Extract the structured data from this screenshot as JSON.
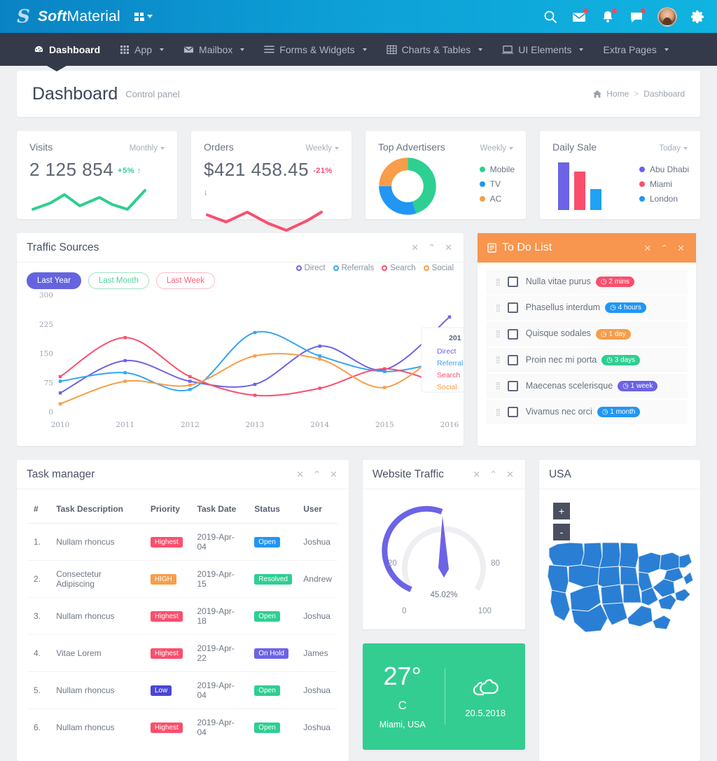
{
  "brand": {
    "bold": "Soft",
    "light": "Material",
    "logo_icon": "s-monogram-icon"
  },
  "topbar": {
    "grid_toggle_icon": "grid-apps-icon",
    "icons": [
      {
        "name": "search-icon",
        "badge": false
      },
      {
        "name": "envelope-icon",
        "badge": true
      },
      {
        "name": "bell-icon",
        "badge": true
      },
      {
        "name": "chat-icon",
        "badge": true
      }
    ],
    "avatar_alt": "user-avatar",
    "settings_icon": "gear-icon"
  },
  "nav": [
    {
      "label": "Dashboard",
      "icon": "dashboard-icon",
      "active": true,
      "caret": false
    },
    {
      "label": "App",
      "icon": "apps-grid-icon",
      "active": false,
      "caret": true
    },
    {
      "label": "Mailbox",
      "icon": "envelope-icon",
      "active": false,
      "caret": true
    },
    {
      "label": "Forms & Widgets",
      "icon": "list-lines-icon",
      "active": false,
      "caret": true
    },
    {
      "label": "Charts & Tables",
      "icon": "table-icon",
      "active": false,
      "caret": true
    },
    {
      "label": "UI Elements",
      "icon": "monitor-icon",
      "active": false,
      "caret": true
    },
    {
      "label": "Extra Pages",
      "icon": "",
      "active": false,
      "caret": true
    }
  ],
  "page": {
    "title": "Dashboard",
    "subtitle": "Control panel",
    "breadcrumb_home": "Home",
    "breadcrumb_sep": ">",
    "breadcrumb_current": "Dashboard",
    "home_icon": "home-icon"
  },
  "stats": {
    "visits": {
      "title": "Visits",
      "period": "Monthly",
      "value": "2 125 854",
      "delta": "+5%",
      "delta_dir": "up",
      "delta_color": "#2ecf8f",
      "line_color": "#2ecf8f"
    },
    "orders": {
      "title": "Orders",
      "period": "Weekly",
      "value": "$421 458.45",
      "delta": "-21%",
      "delta_dir": "down",
      "delta_color": "#fb4e6d",
      "line_color": "#fb4e6d"
    },
    "advertisers": {
      "title": "Top Advertisers",
      "period": "Weekly",
      "legend": [
        {
          "label": "Mobile",
          "color": "#2ecf92",
          "value": 45
        },
        {
          "label": "TV",
          "color": "#2196f3",
          "value": 30
        },
        {
          "label": "AC",
          "color": "#f89d4a",
          "value": 25
        }
      ]
    },
    "daily_sale": {
      "title": "Daily Sale",
      "period": "Today",
      "legend": [
        {
          "label": "Abu Dhabi",
          "color": "#6c63e6",
          "value": 100
        },
        {
          "label": "Miami",
          "color": "#fb4e6d",
          "value": 82
        },
        {
          "label": "London",
          "color": "#1fa2f3",
          "value": 42
        }
      ]
    }
  },
  "traffic": {
    "title": "Traffic Sources",
    "tools": {
      "move": "move-icon",
      "collapse": "chevron-up-icon",
      "close": "close-icon"
    },
    "filters": [
      {
        "label": "Last Year",
        "style": "solid"
      },
      {
        "label": "Last Month",
        "style": "outline-g"
      },
      {
        "label": "Last Week",
        "style": "outline-r"
      }
    ],
    "tooltip": {
      "title": "201",
      "rows": [
        "Direct",
        "Referrals",
        "Search",
        "Social"
      ]
    }
  },
  "chart_data": {
    "type": "line",
    "title": "Traffic Sources",
    "x": [
      "2010",
      "2011",
      "2012",
      "2013",
      "2014",
      "2015",
      "2016"
    ],
    "xlabel": "",
    "ylabel": "",
    "ylim": [
      0,
      300
    ],
    "yticks": [
      0,
      75,
      150,
      225,
      300
    ],
    "grid": false,
    "legend_position": "top-right",
    "series": [
      {
        "name": "Direct",
        "color": "#6c63e6",
        "values": [
          48,
          131,
          78,
          70,
          168,
          108,
          243
        ]
      },
      {
        "name": "Referrals",
        "color": "#35a5f5",
        "values": [
          78,
          100,
          57,
          203,
          143,
          103,
          134
        ]
      },
      {
        "name": "Search",
        "color": "#fb4e6d",
        "values": [
          90,
          190,
          90,
          42,
          60,
          110,
          62
        ]
      },
      {
        "name": "Social",
        "color": "#f89d4a",
        "values": [
          20,
          78,
          68,
          143,
          135,
          62,
          175
        ]
      }
    ]
  },
  "todo": {
    "title": "To Do List",
    "icon": "clipboard-icon",
    "tools": {
      "move": "move-icon",
      "collapse": "chevron-up-icon",
      "close": "close-icon"
    },
    "items": [
      {
        "text": "Nulla vitae purus",
        "badge": "2 mins",
        "color": "#fb4e6d"
      },
      {
        "text": "Phasellus interdum",
        "badge": "4 hours",
        "color": "#2196f3"
      },
      {
        "text": "Quisque sodales",
        "badge": "1 day",
        "color": "#f89d4a"
      },
      {
        "text": "Proin nec mi porta",
        "badge": "3 days",
        "color": "#2ecf92"
      },
      {
        "text": "Maecenas scelerisque",
        "badge": "1 week",
        "color": "#6c63e6"
      },
      {
        "text": "Vivamus nec orci",
        "badge": "1 month",
        "color": "#2196f3"
      }
    ],
    "clock_icon": "clock-icon",
    "drag_icon": "drag-handle-icon"
  },
  "task_manager": {
    "title": "Task manager",
    "tools": {
      "move": "move-icon",
      "collapse": "chevron-up-icon",
      "close": "close-icon"
    },
    "columns": [
      "#",
      "Task Description",
      "Priority",
      "Task Date",
      "Status",
      "User"
    ],
    "rows": [
      {
        "num": "1.",
        "desc": "Nullam rhoncus",
        "priority": "Highest",
        "priority_color": "#fb4e6d",
        "date": "2019-Apr-04",
        "status": "Open",
        "status_color": "#2196f3",
        "user": "Joshua"
      },
      {
        "num": "2.",
        "desc": "Consectetur Adipiscing",
        "priority": "HIGH",
        "priority_color": "#f89d4a",
        "date": "2019-Apr-15",
        "status": "Resolved",
        "status_color": "#2ecf92",
        "user": "Andrew"
      },
      {
        "num": "3.",
        "desc": "Nullam rhoncus",
        "priority": "Highest",
        "priority_color": "#fb4e6d",
        "date": "2019-Apr-18",
        "status": "Open",
        "status_color": "#2ecf92",
        "user": "Joshua"
      },
      {
        "num": "4.",
        "desc": "Vitae Lorem",
        "priority": "Highest",
        "priority_color": "#fb4e6d",
        "date": "2019-Apr-22",
        "status": "On Hold",
        "status_color": "#6c63e6",
        "user": "James"
      },
      {
        "num": "5.",
        "desc": "Nullam rhoncus",
        "priority": "Low",
        "priority_color": "#4a47d6",
        "date": "2019-Apr-04",
        "status": "Open",
        "status_color": "#2ecf92",
        "user": "Joshua"
      },
      {
        "num": "6.",
        "desc": "Nullam rhoncus",
        "priority": "Highest",
        "priority_color": "#fb4e6d",
        "date": "2019-Apr-04",
        "status": "Open",
        "status_color": "#2ecf92",
        "user": "Joshua"
      }
    ]
  },
  "website_traffic": {
    "title": "Website Traffic",
    "tools": {
      "move": "move-icon",
      "collapse": "chevron-up-icon",
      "close": "close-icon"
    },
    "gauge": {
      "value_label": "45.02%",
      "value": 45.02,
      "min_label": "0",
      "max_label": "100",
      "left_label": "20",
      "right_label": "80",
      "arc_color": "#6c63e6",
      "track_color": "#efeff3"
    }
  },
  "weather": {
    "temperature": "27°",
    "unit": "C",
    "location": "Miami, USA",
    "date": "20.5.2018",
    "icon": "cloud-icon",
    "bg_color": "#33cd92"
  },
  "map": {
    "title": "USA",
    "zoom_in": "+",
    "zoom_out": "-",
    "fill_color": "#2a7fd4",
    "icon": "us-map-icon"
  }
}
